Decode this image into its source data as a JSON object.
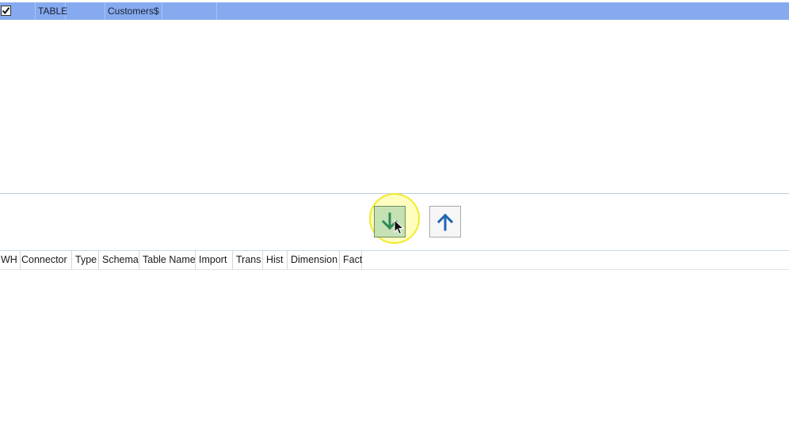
{
  "source_grid": {
    "row": {
      "checked": true,
      "type": "TABLE",
      "schema": "",
      "table_name": "Customers$",
      "extra": ""
    },
    "selection_color": "#86aaf0"
  },
  "toolbar": {
    "move_down_icon": "arrow-down-icon",
    "move_up_icon": "arrow-up-icon",
    "move_down_color": "#2e8b57",
    "move_up_color": "#1f64b4"
  },
  "target_grid": {
    "columns": [
      "WH",
      "Connector",
      "Type",
      "Schema",
      "Table Name",
      "Import",
      "Trans",
      "Hist",
      "Dimension",
      "Fact"
    ]
  }
}
